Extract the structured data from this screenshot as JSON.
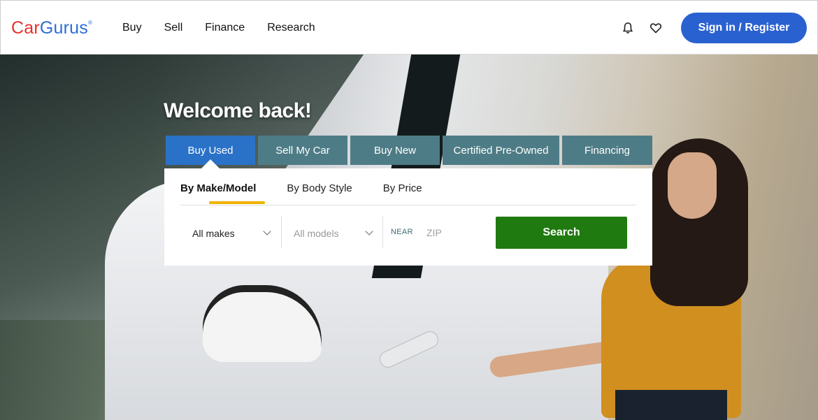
{
  "header": {
    "logo": {
      "part1": "Car",
      "part2": "Gurus",
      "mark": "®"
    },
    "nav": [
      "Buy",
      "Sell",
      "Finance",
      "Research"
    ],
    "icons": [
      "bell-icon",
      "heart-icon"
    ],
    "signin_label": "Sign in / Register"
  },
  "hero": {
    "welcome": "Welcome back!",
    "tabs": [
      {
        "label": "Buy Used",
        "active": true
      },
      {
        "label": "Sell My Car",
        "active": false
      },
      {
        "label": "Buy New",
        "active": false
      },
      {
        "label": "Certified Pre-Owned",
        "active": false
      },
      {
        "label": "Financing",
        "active": false
      }
    ],
    "search_panel": {
      "subtabs": [
        {
          "label": "By Make/Model",
          "active": true
        },
        {
          "label": "By Body Style",
          "active": false
        },
        {
          "label": "By Price",
          "active": false
        }
      ],
      "make_value": "All makes",
      "model_value": "All models",
      "near_label": "NEAR",
      "zip_placeholder": "ZIP",
      "search_label": "Search"
    }
  },
  "colors": {
    "brand_red": "#e8322b",
    "brand_blue": "#2b6ed6",
    "signin_bg": "#2a61d1",
    "tab_active": "#2a72c7",
    "tab_inactive": "#4e7c86",
    "search_green": "#1f7a0f",
    "underline_yellow": "#f0b400"
  }
}
